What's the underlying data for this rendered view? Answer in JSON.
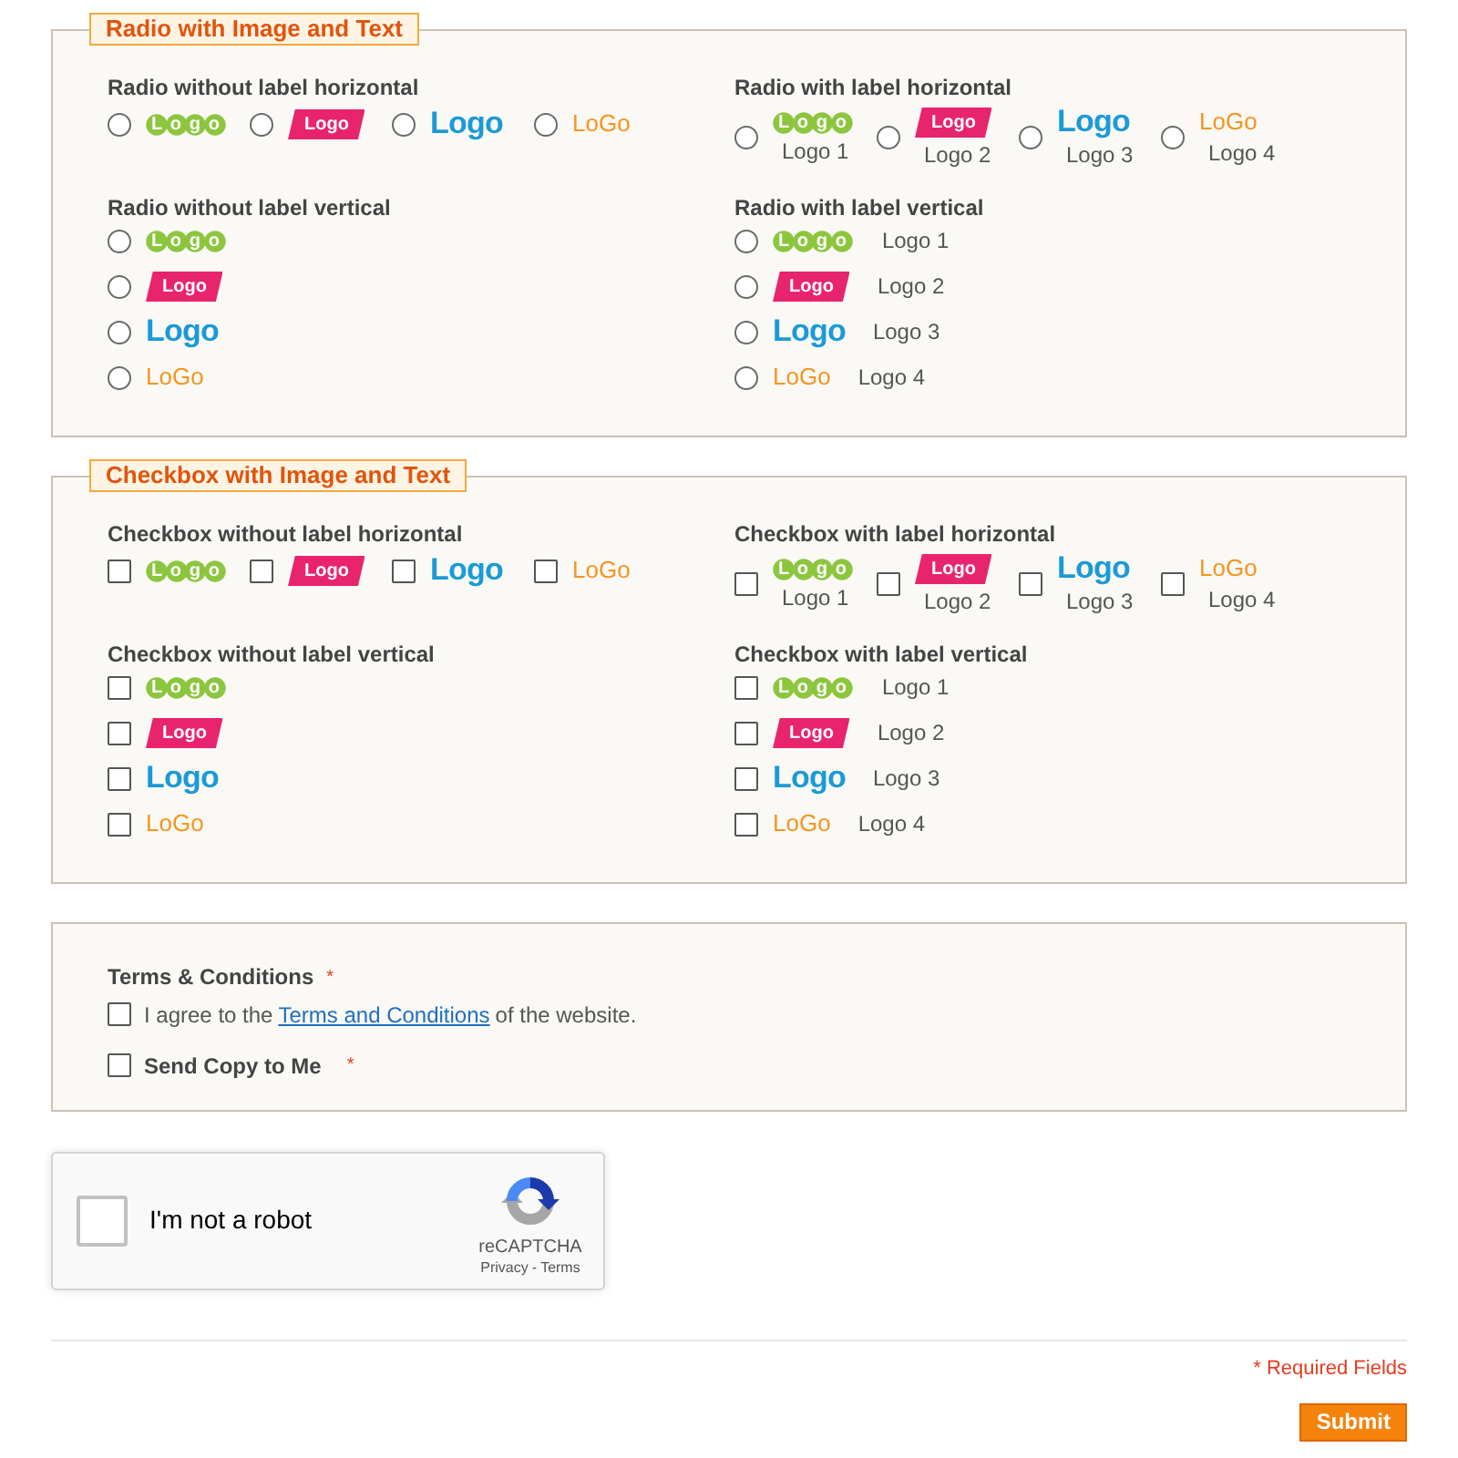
{
  "sections": [
    {
      "legend": "Radio with Image and Text",
      "kind": "radio",
      "groups": [
        {
          "title": "Radio without label horizontal",
          "kind": "horizontal",
          "options": [
            {
              "logo": {
                "kind": "circles",
                "text": "Logo"
              },
              "selected": false
            },
            {
              "logo": {
                "kind": "tag",
                "text": "Logo"
              },
              "selected": false
            },
            {
              "logo": {
                "kind": "bold",
                "text": "Logo"
              },
              "selected": false
            },
            {
              "logo": {
                "kind": "light",
                "text": "LoGo"
              },
              "selected": false
            }
          ]
        },
        {
          "title": "Radio with label horizontal",
          "kind": "horizontal",
          "options": [
            {
              "logo": {
                "kind": "circles",
                "text": "Logo"
              },
              "label": "Logo 1",
              "selected": false
            },
            {
              "logo": {
                "kind": "tag",
                "text": "Logo"
              },
              "label": "Logo 2",
              "selected": false
            },
            {
              "logo": {
                "kind": "bold",
                "text": "Logo"
              },
              "label": "Logo 3",
              "selected": false
            },
            {
              "logo": {
                "kind": "light",
                "text": "LoGo"
              },
              "label": "Logo 4",
              "selected": false
            }
          ]
        },
        {
          "title": "Radio without label vertical",
          "kind": "vertical",
          "options": [
            {
              "logo": {
                "kind": "circles",
                "text": "Logo"
              },
              "selected": false
            },
            {
              "logo": {
                "kind": "tag",
                "text": "Logo"
              },
              "selected": false
            },
            {
              "logo": {
                "kind": "bold",
                "text": "Logo"
              },
              "selected": false
            },
            {
              "logo": {
                "kind": "light",
                "text": "LoGo"
              },
              "selected": false
            }
          ]
        },
        {
          "title": "Radio with label vertical",
          "kind": "vertical",
          "options": [
            {
              "logo": {
                "kind": "circles",
                "text": "Logo"
              },
              "label": "Logo 1",
              "selected": false
            },
            {
              "logo": {
                "kind": "tag",
                "text": "Logo"
              },
              "label": "Logo 2",
              "selected": false
            },
            {
              "logo": {
                "kind": "bold",
                "text": "Logo"
              },
              "label": "Logo 3",
              "selected": false
            },
            {
              "logo": {
                "kind": "light",
                "text": "LoGo"
              },
              "label": "Logo 4",
              "selected": false
            }
          ]
        }
      ]
    },
    {
      "legend": "Checkbox with Image and Text",
      "kind": "checkbox",
      "groups": [
        {
          "title": "Checkbox without label horizontal",
          "kind": "horizontal",
          "options": [
            {
              "logo": {
                "kind": "circles",
                "text": "Logo"
              },
              "checked": false
            },
            {
              "logo": {
                "kind": "tag",
                "text": "Logo"
              },
              "checked": false
            },
            {
              "logo": {
                "kind": "bold",
                "text": "Logo"
              },
              "checked": false
            },
            {
              "logo": {
                "kind": "light",
                "text": "LoGo"
              },
              "checked": false
            }
          ]
        },
        {
          "title": "Checkbox with label horizontal",
          "kind": "horizontal",
          "options": [
            {
              "logo": {
                "kind": "circles",
                "text": "Logo"
              },
              "label": "Logo 1",
              "checked": false
            },
            {
              "logo": {
                "kind": "tag",
                "text": "Logo"
              },
              "label": "Logo 2",
              "checked": false
            },
            {
              "logo": {
                "kind": "bold",
                "text": "Logo"
              },
              "label": "Logo 3",
              "checked": false
            },
            {
              "logo": {
                "kind": "light",
                "text": "LoGo"
              },
              "label": "Logo 4",
              "checked": false
            }
          ]
        },
        {
          "title": "Checkbox without label vertical",
          "kind": "vertical",
          "options": [
            {
              "logo": {
                "kind": "circles",
                "text": "Logo"
              },
              "checked": false
            },
            {
              "logo": {
                "kind": "tag",
                "text": "Logo"
              },
              "checked": false
            },
            {
              "logo": {
                "kind": "bold",
                "text": "Logo"
              },
              "checked": false
            },
            {
              "logo": {
                "kind": "light",
                "text": "LoGo"
              },
              "checked": false
            }
          ]
        },
        {
          "title": "Checkbox with label vertical",
          "kind": "vertical",
          "options": [
            {
              "logo": {
                "kind": "circles",
                "text": "Logo"
              },
              "label": "Logo 1",
              "checked": false
            },
            {
              "logo": {
                "kind": "tag",
                "text": "Logo"
              },
              "label": "Logo 2",
              "checked": false
            },
            {
              "logo": {
                "kind": "bold",
                "text": "Logo"
              },
              "label": "Logo 3",
              "checked": false
            },
            {
              "logo": {
                "kind": "light",
                "text": "LoGo"
              },
              "label": "Logo 4",
              "checked": false
            }
          ]
        }
      ]
    }
  ],
  "agreement": {
    "title": "Terms & Conditions",
    "required_mark": "*",
    "items": [
      {
        "kind": "sentence",
        "checked": false,
        "text_before": "I agree to the",
        "link": "Terms and Conditions",
        "text_after": "of the website."
      },
      {
        "kind": "label",
        "checked": false,
        "label": "Send Copy to Me",
        "required_mark": "*"
      }
    ]
  },
  "captcha": {
    "checked": false,
    "label": "I'm not a robot",
    "brand": "reCAPTCHA",
    "links": [
      "Privacy",
      "Terms"
    ],
    "link_separator": "-"
  },
  "footer": {
    "required_note": "* Required Fields",
    "submit": "Submit"
  }
}
